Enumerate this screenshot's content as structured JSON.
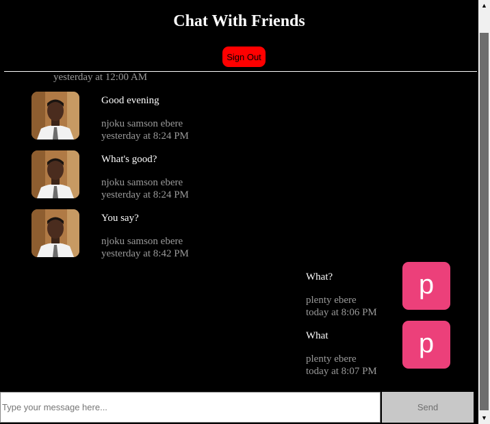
{
  "header": {
    "title": "Chat With Friends",
    "sign_out_label": "Sign Out"
  },
  "stray_timestamp": "yesterday at 12:00 AM",
  "messages": [
    {
      "text": "Good evening",
      "author": "njoku samson ebere",
      "time": "yesterday at 8:24 PM",
      "side": "left",
      "avatar": "photo"
    },
    {
      "text": "What's good?",
      "author": "njoku samson ebere",
      "time": "yesterday at 8:24 PM",
      "side": "left",
      "avatar": "photo"
    },
    {
      "text": "You say?",
      "author": "njoku samson ebere",
      "time": "yesterday at 8:42 PM",
      "side": "left",
      "avatar": "photo"
    },
    {
      "text": "What?",
      "author": "plenty ebere",
      "time": "today at 8:06 PM",
      "side": "right",
      "avatar": "p"
    },
    {
      "text": "What",
      "author": "plenty ebere",
      "time": "today at 8:07 PM",
      "side": "right",
      "avatar": "p"
    }
  ],
  "composer": {
    "placeholder": "Type your message here...",
    "send_label": "Send"
  },
  "colors": {
    "sign_out": "#ff0000",
    "avatar_letter_bg": "#ec407a",
    "send_bg": "#c8c8c8"
  }
}
